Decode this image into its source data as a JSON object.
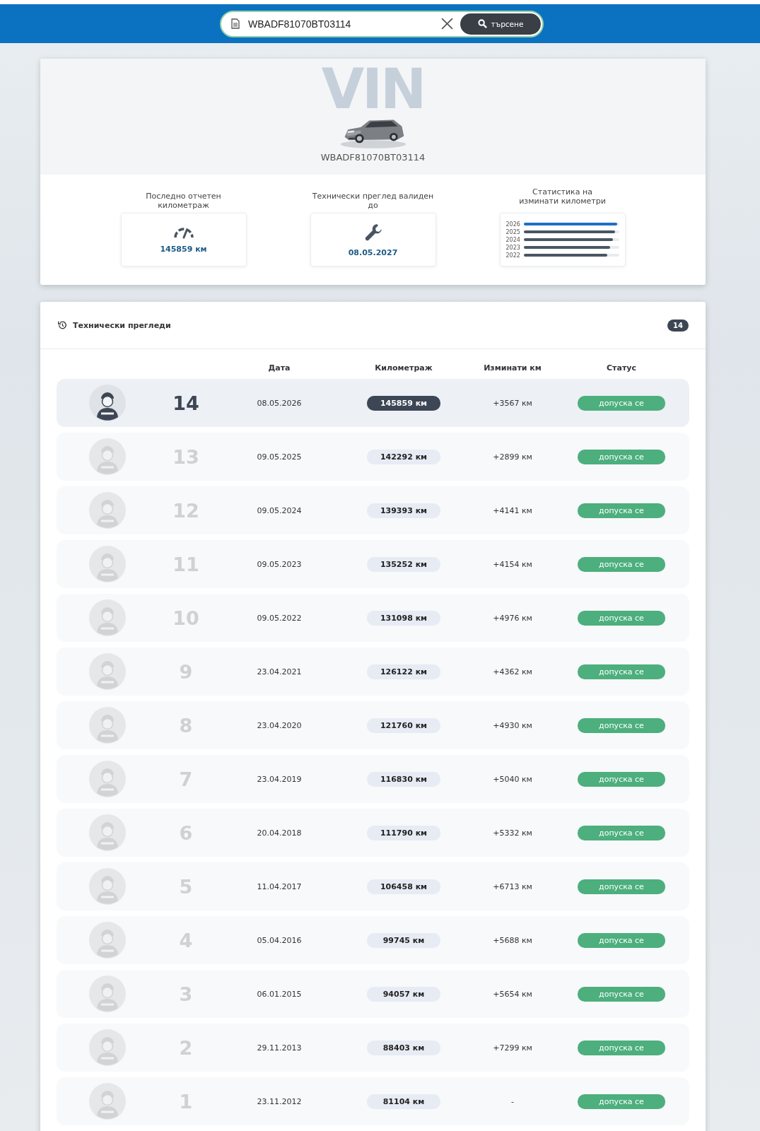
{
  "search": {
    "value": "WBADF81070BT03114",
    "button": "търсене"
  },
  "vehicle": {
    "backdrop_text": "VIN",
    "vin": "WBADF81070BT03114"
  },
  "summary": [
    {
      "kind": "mileage",
      "label": "Последно отчетен километраж",
      "value": "145859 км"
    },
    {
      "kind": "inspection",
      "label": "Технически преглед валиден до",
      "value": "08.05.2027"
    }
  ],
  "stats": {
    "label": "Статистика на изминати километри",
    "bars": [
      {
        "label": "2026",
        "level": 0.98,
        "selected": true
      },
      {
        "label": "2025",
        "level": 0.96,
        "selected": false
      },
      {
        "label": "2024",
        "level": 0.94,
        "selected": false
      },
      {
        "label": "2023",
        "level": 0.91,
        "selected": false
      },
      {
        "label": "2022",
        "level": 0.88,
        "selected": false
      }
    ]
  },
  "inspections": {
    "title": "Технически прегледи",
    "count": "14",
    "columns": [
      "Дата",
      "Километраж",
      "Изминати км",
      "Статус"
    ],
    "rows": [
      {
        "number": "14",
        "date": "08.05.2026",
        "mileage": "145859 км",
        "delta": "+3567 км",
        "status": "допуска се",
        "selected": true
      },
      {
        "number": "13",
        "date": "09.05.2025",
        "mileage": "142292 км",
        "delta": "+2899 км",
        "status": "допуска се",
        "selected": false
      },
      {
        "number": "12",
        "date": "09.05.2024",
        "mileage": "139393 км",
        "delta": "+4141 км",
        "status": "допуска се",
        "selected": false
      },
      {
        "number": "11",
        "date": "09.05.2023",
        "mileage": "135252 км",
        "delta": "+4154 км",
        "status": "допуска се",
        "selected": false
      },
      {
        "number": "10",
        "date": "09.05.2022",
        "mileage": "131098 км",
        "delta": "+4976 км",
        "status": "допуска се",
        "selected": false
      },
      {
        "number": "9",
        "date": "23.04.2021",
        "mileage": "126122 км",
        "delta": "+4362 км",
        "status": "допуска се",
        "selected": false
      },
      {
        "number": "8",
        "date": "23.04.2020",
        "mileage": "121760 км",
        "delta": "+4930 км",
        "status": "допуска се",
        "selected": false
      },
      {
        "number": "7",
        "date": "23.04.2019",
        "mileage": "116830 км",
        "delta": "+5040 км",
        "status": "допуска се",
        "selected": false
      },
      {
        "number": "6",
        "date": "20.04.2018",
        "mileage": "111790 км",
        "delta": "+5332 км",
        "status": "допуска се",
        "selected": false
      },
      {
        "number": "5",
        "date": "11.04.2017",
        "mileage": "106458 км",
        "delta": "+6713 км",
        "status": "допуска се",
        "selected": false
      },
      {
        "number": "4",
        "date": "05.04.2016",
        "mileage": "99745 км",
        "delta": "+5688 км",
        "status": "допуска се",
        "selected": false
      },
      {
        "number": "3",
        "date": "06.01.2015",
        "mileage": "94057 км",
        "delta": "+5654 км",
        "status": "допуска се",
        "selected": false
      },
      {
        "number": "2",
        "date": "29.11.2013",
        "mileage": "88403 км",
        "delta": "+7299 км",
        "status": "допуска се",
        "selected": false
      },
      {
        "number": "1",
        "date": "23.11.2012",
        "mileage": "81104 км",
        "delta": "-",
        "status": "допуска се",
        "selected": false
      }
    ]
  }
}
